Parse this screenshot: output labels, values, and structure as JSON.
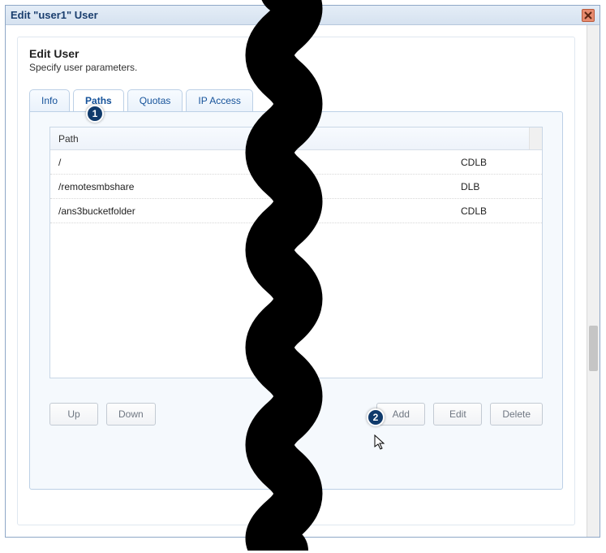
{
  "dialog": {
    "title": "Edit \"user1\" User"
  },
  "header": {
    "title": "Edit User",
    "subtitle": "Specify user parameters."
  },
  "tabs": [
    {
      "label": "Info"
    },
    {
      "label": "Paths",
      "active": true
    },
    {
      "label": "Quotas"
    },
    {
      "label": "IP Access"
    }
  ],
  "table": {
    "columns": {
      "path": "Path",
      "perm": ""
    },
    "rows": [
      {
        "path": "/",
        "perm": "CDLB"
      },
      {
        "path": "/remotesmbshare",
        "perm": "DLB"
      },
      {
        "path": "/ans3bucketfolder",
        "perm": "CDLB"
      }
    ]
  },
  "buttons": {
    "up": "Up",
    "down": "Down",
    "add": "Add",
    "edit": "Edit",
    "delete": "Delete"
  },
  "badges": {
    "one": "1",
    "two": "2"
  }
}
